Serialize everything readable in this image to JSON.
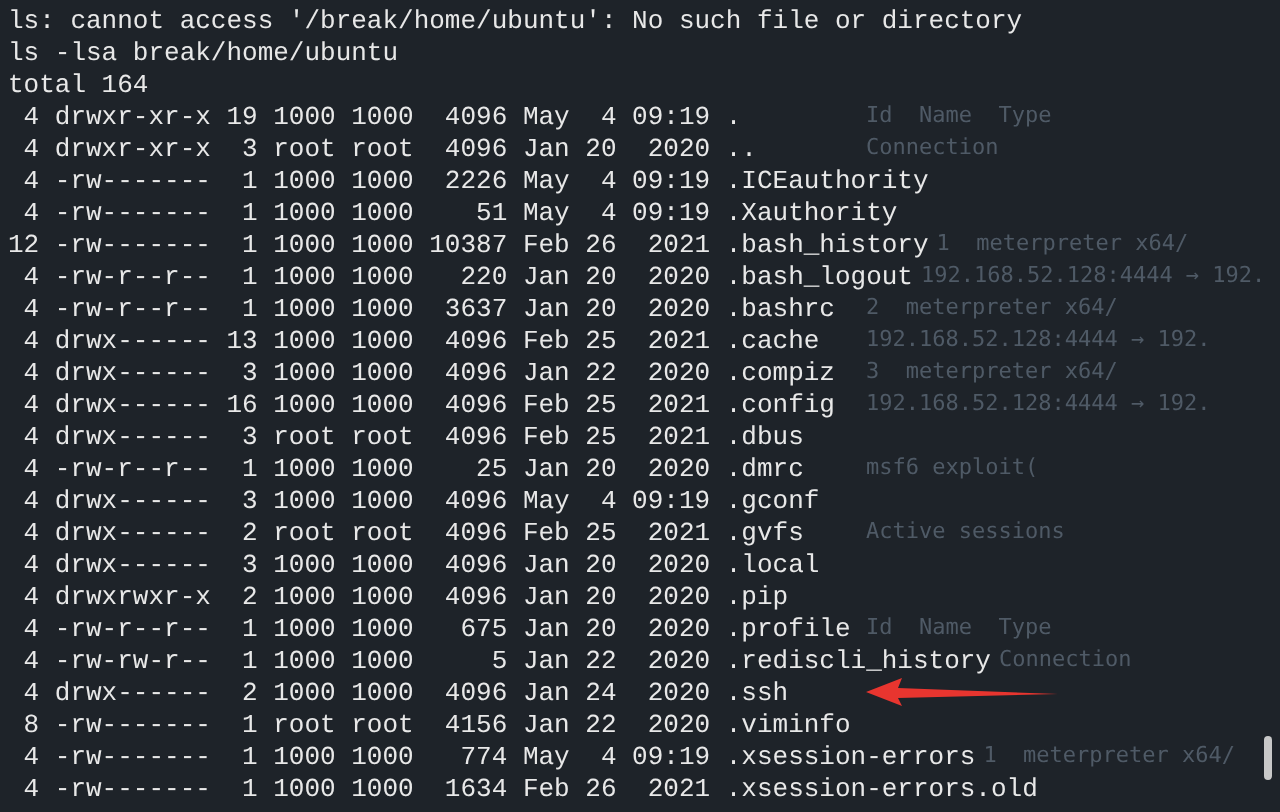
{
  "terminal": {
    "lines": [
      {
        "text": "ls: cannot access '/break/home/ubuntu': No such file or directory",
        "marked": false
      },
      {
        "text": "ls -lsa break/home/ubuntu",
        "marked": false
      },
      {
        "text": "total 164",
        "marked": false
      },
      {
        "text": " 4 drwxr-xr-x 19 1000 1000  4096 May  4 09:19 .",
        "marked": false,
        "background_text": "Id  Name  Type"
      },
      {
        "text": " 4 drwxr-xr-x  3 root root  4096 Jan 20  2020 ..",
        "marked": false,
        "background_text": "Connection"
      },
      {
        "text": " 4 -rw-------  1 1000 1000  2226 May  4 09:19 .ICEauthority",
        "marked": false
      },
      {
        "text": " 4 -rw-------  1 1000 1000    51 May  4 09:19 .Xauthority",
        "marked": false
      },
      {
        "text": "12 -rw-------  1 1000 1000 10387 Feb 26  2021 .bash_history",
        "marked": false,
        "background_text": "1  meterpreter x64/"
      },
      {
        "text": " 4 -rw-r--r--  1 1000 1000   220 Jan 20  2020 .bash_logout",
        "marked": false,
        "background_text": "192.168.52.128:4444 → 192."
      },
      {
        "text": " 4 -rw-r--r--  1 1000 1000  3637 Jan 20  2020 .bashrc",
        "marked": false,
        "background_text": "2  meterpreter x64/"
      },
      {
        "text": " 4 drwx------ 13 1000 1000  4096 Feb 25  2021 .cache",
        "marked": false,
        "background_text": "192.168.52.128:4444 → 192."
      },
      {
        "text": " 4 drwx------  3 1000 1000  4096 Jan 22  2020 .compiz",
        "marked": false,
        "background_text": "3  meterpreter x64/"
      },
      {
        "text": " 4 drwx------ 16 1000 1000  4096 Feb 25  2021 .config",
        "marked": false,
        "background_text": "192.168.52.128:4444 → 192."
      },
      {
        "text": " 4 drwx------  3 root root  4096 Feb 25  2021 .dbus",
        "marked": false
      },
      {
        "text": " 4 -rw-r--r--  1 1000 1000    25 Jan 20  2020 .dmrc",
        "marked": false,
        "background_text": "msf6 exploit("
      },
      {
        "text": " 4 drwx------  3 1000 1000  4096 May  4 09:19 .gconf",
        "marked": false
      },
      {
        "text": " 4 drwx------  2 root root  4096 Feb 25  2021 .gvfs",
        "marked": false,
        "background_text": "Active sessions"
      },
      {
        "text": " 4 drwx------  3 1000 1000  4096 Jan 20  2020 .local",
        "marked": false
      },
      {
        "text": " 4 drwxrwxr-x  2 1000 1000  4096 Jan 20  2020 .pip",
        "marked": false
      },
      {
        "text": " 4 -rw-r--r--  1 1000 1000   675 Jan 20  2020 .profile",
        "marked": false,
        "background_text": "Id  Name  Type"
      },
      {
        "text": " 4 -rw-rw-r--  1 1000 1000     5 Jan 22  2020 .rediscli_history",
        "marked": false,
        "background_text": "Connection"
      },
      {
        "text": " 4 drwx------  2 1000 1000  4096 Jan 24  2020 .ssh",
        "marked": true
      },
      {
        "text": " 8 -rw-------  1 root root  4156 Jan 22  2020 .viminfo",
        "marked": false
      },
      {
        "text": " 4 -rw-------  1 1000 1000   774 May  4 09:19 .xsession-errors",
        "marked": false,
        "background_text": "1  meterpreter x64/"
      },
      {
        "text": " 4 -rw-------  1 1000 1000  1634 Feb 26  2021 .xsession-errors.old",
        "marked": false
      }
    ]
  }
}
